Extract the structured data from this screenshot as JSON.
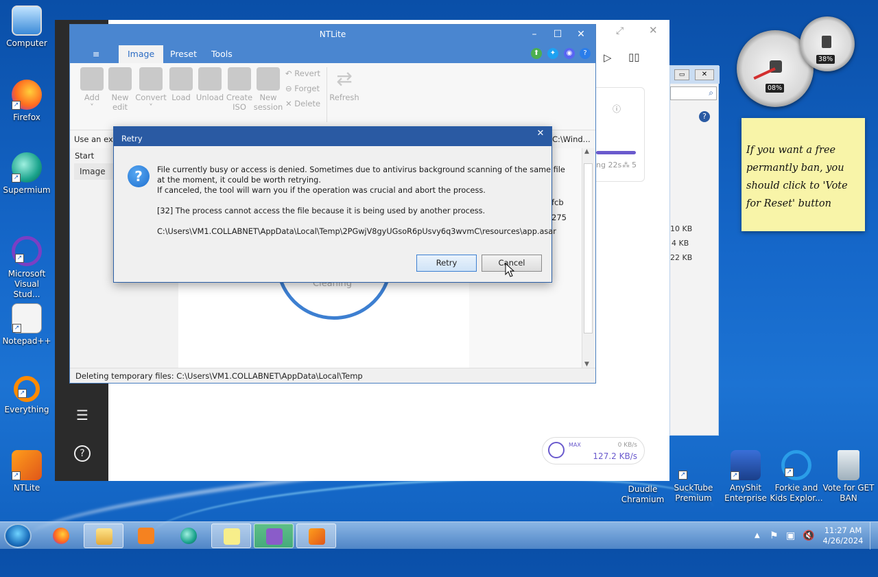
{
  "desktop_icons": {
    "computer": "Computer",
    "firefox": "Firefox",
    "supermium": "Supermium",
    "visual_studio": "Microsoft Visual Stud...",
    "notepadpp": "Notepad++",
    "everything": "Everything",
    "ntlite": "NTLite",
    "duudle": "Duudle Chramium",
    "sucktube": "SuckTube Premium",
    "anyshit": "AnyShit Enterprise",
    "forkie": "Forkie and Kids Explor...",
    "vote": "Vote for GET BAN"
  },
  "ntlite": {
    "title": "NTLite",
    "menu_icon": "≡",
    "tabs": [
      "Image",
      "Preset",
      "Tools"
    ],
    "ribbon": {
      "add": "Add",
      "new_edit_1": "New",
      "new_edit_2": "edit",
      "convert": "Convert",
      "load": "Load",
      "unload": "Unload",
      "create_iso_1": "Create",
      "create_iso_2": "ISO",
      "new_session_1": "New",
      "new_session_2": "session",
      "revert": "Revert",
      "forget": "Forget",
      "delete": "Delete",
      "refresh": "Refresh"
    },
    "use_an_existing": "Use an exis",
    "path_fragment": "C:\\Wind...",
    "start_col": "Start",
    "image_row": "Image",
    "cleaning": "Cleaning",
    "hash_1": "fcb",
    "hash_2": "275",
    "status_bar": "Deleting temporary files: C:\\Users\\VM1.COLLABNET\\AppData\\Local\\Temp"
  },
  "background_window": {
    "eta": "ng 22s",
    "peers": "5",
    "size_1": "10 KB",
    "size_2": "4 KB",
    "size_3": "22 KB",
    "speed_max": "MAX",
    "speed_up": "0 KB/s",
    "speed_down": "127.2 KB/s"
  },
  "dialog": {
    "title": "Retry",
    "line1": "File currently busy or access is denied. Sometimes due to antivirus background scanning of the same file",
    "line2": "at the moment, it could be worth retrying.",
    "line3": "If canceled, the tool will warn you if the operation was crucial and abort the process.",
    "error": "[32] The process cannot access the file because it is being used by another process.",
    "path": "C:\\Users\\VM1.COLLABNET\\AppData\\Local\\Temp\\2PGwjV8gyUGsoR6pUsvy6q3wvmC\\resources\\app.asar",
    "retry": "Retry",
    "cancel": "Cancel"
  },
  "sticky_note": {
    "text": "If you want a free permantly ban, you should click to 'Vote for Reset' button"
  },
  "gadget": {
    "cpu": "08%",
    "mem": "38%"
  },
  "taskbar": {
    "time": "11:27 AM",
    "date": "4/26/2024"
  },
  "colors": {
    "ntlite_blue": "#4a86d0",
    "dialog_title": "#2a5aa3",
    "desktop": "#1567c9"
  }
}
